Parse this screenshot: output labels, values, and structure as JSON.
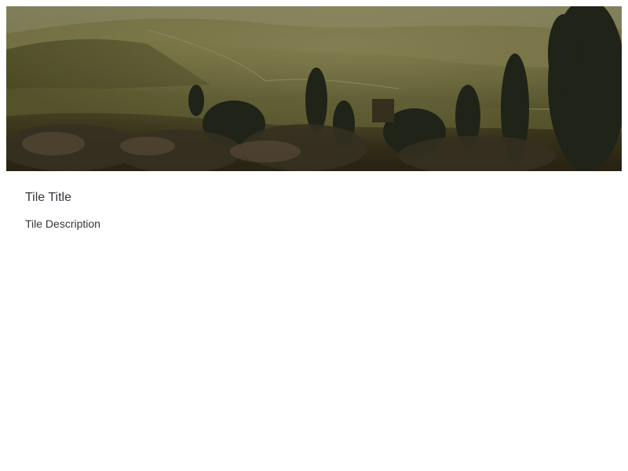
{
  "tile": {
    "title": "Tile Title",
    "description": "Tile Description",
    "image": {
      "subject": "landscape-photo",
      "palette": {
        "sky": "#8a8760",
        "hills": "#77743f",
        "shadow": "#2d2a18",
        "trees": "#23261a"
      }
    }
  }
}
